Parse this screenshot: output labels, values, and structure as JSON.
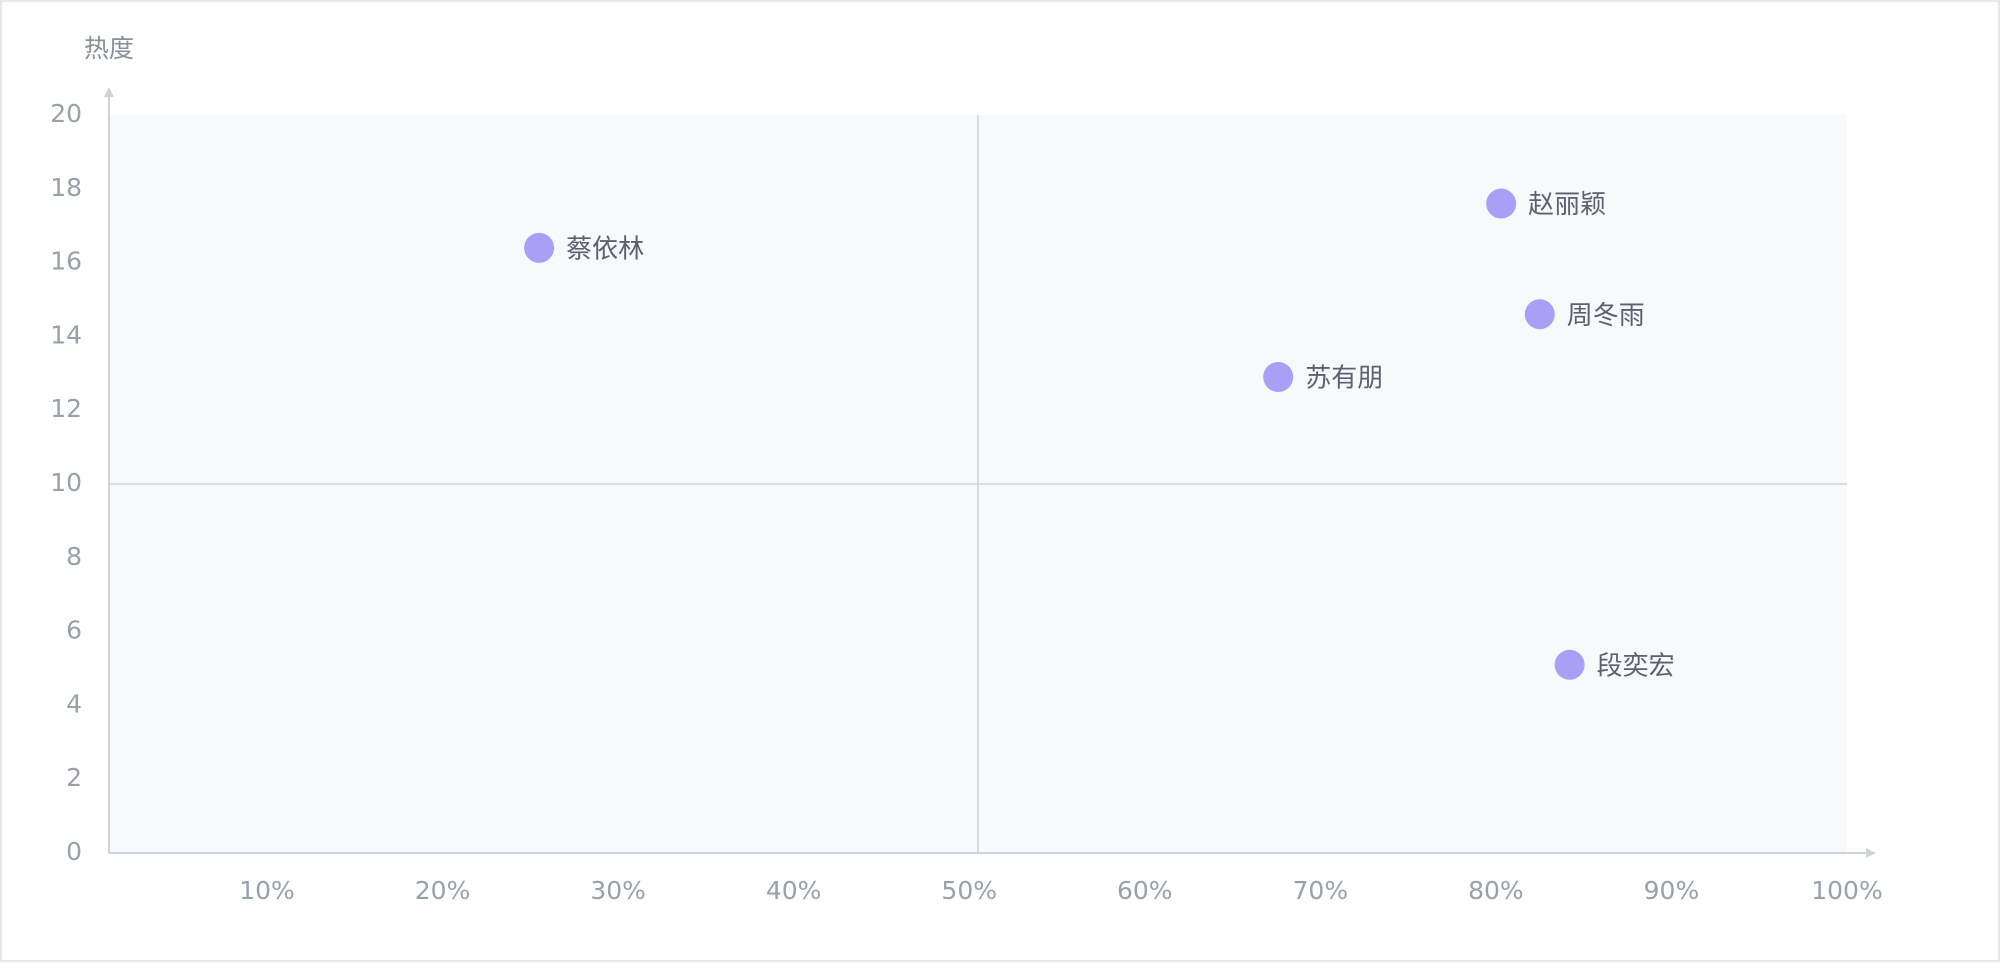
{
  "chart_data": {
    "type": "scatter",
    "ylabel": "热度",
    "xlabel": "",
    "xlim": [
      1,
      100
    ],
    "ylim": [
      0,
      20
    ],
    "x_ticks": [
      "10%",
      "20%",
      "30%",
      "40%",
      "50%",
      "60%",
      "70%",
      "80%",
      "90%",
      "100%"
    ],
    "y_ticks": [
      "0",
      "2",
      "4",
      "6",
      "8",
      "10",
      "12",
      "14",
      "16",
      "18",
      "20"
    ],
    "quadrant_lines": {
      "x": 50.5,
      "y": 10
    },
    "point_color": "#ab9ef7",
    "plot_background": "#f8f9fa",
    "points": [
      {
        "label": "蔡依林",
        "x": 25.5,
        "y": 16.4
      },
      {
        "label": "赵丽颖",
        "x": 80.3,
        "y": 17.6
      },
      {
        "label": "周冬雨",
        "x": 82.5,
        "y": 14.6
      },
      {
        "label": "苏有朋",
        "x": 67.6,
        "y": 12.9
      },
      {
        "label": "段奕宏",
        "x": 84.2,
        "y": 5.1
      }
    ]
  }
}
